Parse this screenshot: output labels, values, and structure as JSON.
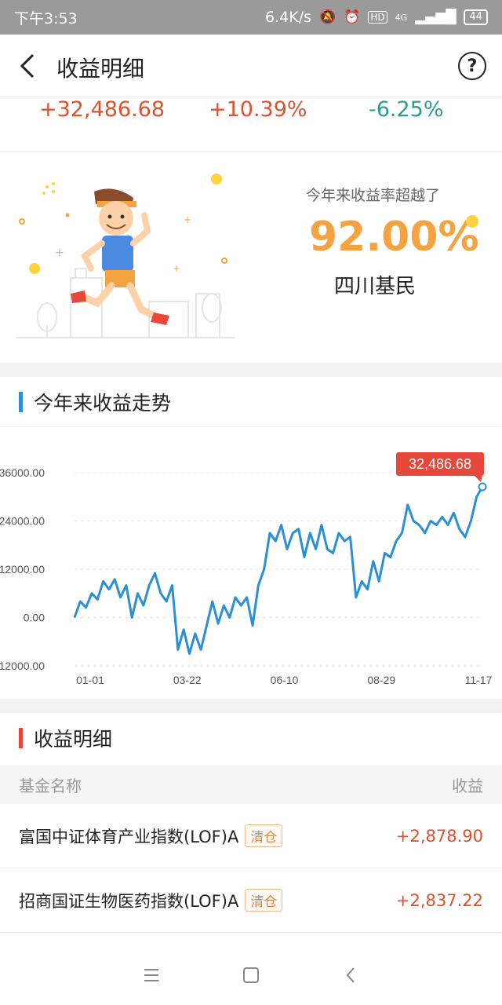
{
  "statusbar": {
    "time": "下午3:53",
    "net_speed": "6.4K/s",
    "hd_label": "HD",
    "net_type": "4G",
    "battery": "44"
  },
  "header": {
    "title": "收益明细"
  },
  "summary": {
    "total_profit": "+32,486.68",
    "return_rate": "+10.39%",
    "benchmark_rate": "-6.25%"
  },
  "ranking": {
    "label": "今年来收益率超越了",
    "percent": "92.00%",
    "group": "四川基民"
  },
  "trend": {
    "title": "今年来收益走势",
    "bar_color": "#2b8fd6"
  },
  "chart_data": {
    "type": "line",
    "title": "今年来收益走势",
    "ylim": [
      -12000,
      36000
    ],
    "y_ticks": [
      "36000.00",
      "24000.00",
      "12000.00",
      "0.00",
      "-12000.00"
    ],
    "x_ticks": [
      "01-01",
      "03-22",
      "06-10",
      "08-29",
      "11-17"
    ],
    "end_label": "32,486.68",
    "line_color": "#2b8fd6",
    "label_color": "#e8473b",
    "series": [
      {
        "values": [
          0,
          4000,
          2500,
          6000,
          4500,
          9000,
          7000,
          9500,
          5000,
          8000,
          0,
          6000,
          3000,
          8000,
          11000,
          6000,
          4000,
          8000,
          -8000,
          -3000,
          -9000,
          -4000,
          -8000,
          -2000,
          4000,
          -1500,
          3000,
          0,
          5000,
          3000,
          5000,
          -2000,
          8000,
          12000,
          21000,
          19000,
          23000,
          17000,
          21000,
          22000,
          15000,
          21000,
          17000,
          23000,
          17000,
          16000,
          21000,
          19000,
          20000,
          5000,
          9000,
          7000,
          14000,
          9000,
          16000,
          15000,
          19000,
          21000,
          28000,
          24000,
          23000,
          21000,
          24000,
          23000,
          25000,
          23000,
          26000,
          22000,
          20000,
          24000,
          30000,
          32486.68
        ]
      }
    ]
  },
  "detail": {
    "title": "收益明细",
    "bar_color": "#e8473b",
    "col_name": "基金名称",
    "col_profit": "收益",
    "rows": [
      {
        "name": "富国中证体育产业指数(LOF)A",
        "tag": "清仓",
        "profit": "+2,878.90"
      },
      {
        "name": "招商国证生物医药指数(LOF)A",
        "tag": "清仓",
        "profit": "+2,837.22"
      }
    ]
  }
}
